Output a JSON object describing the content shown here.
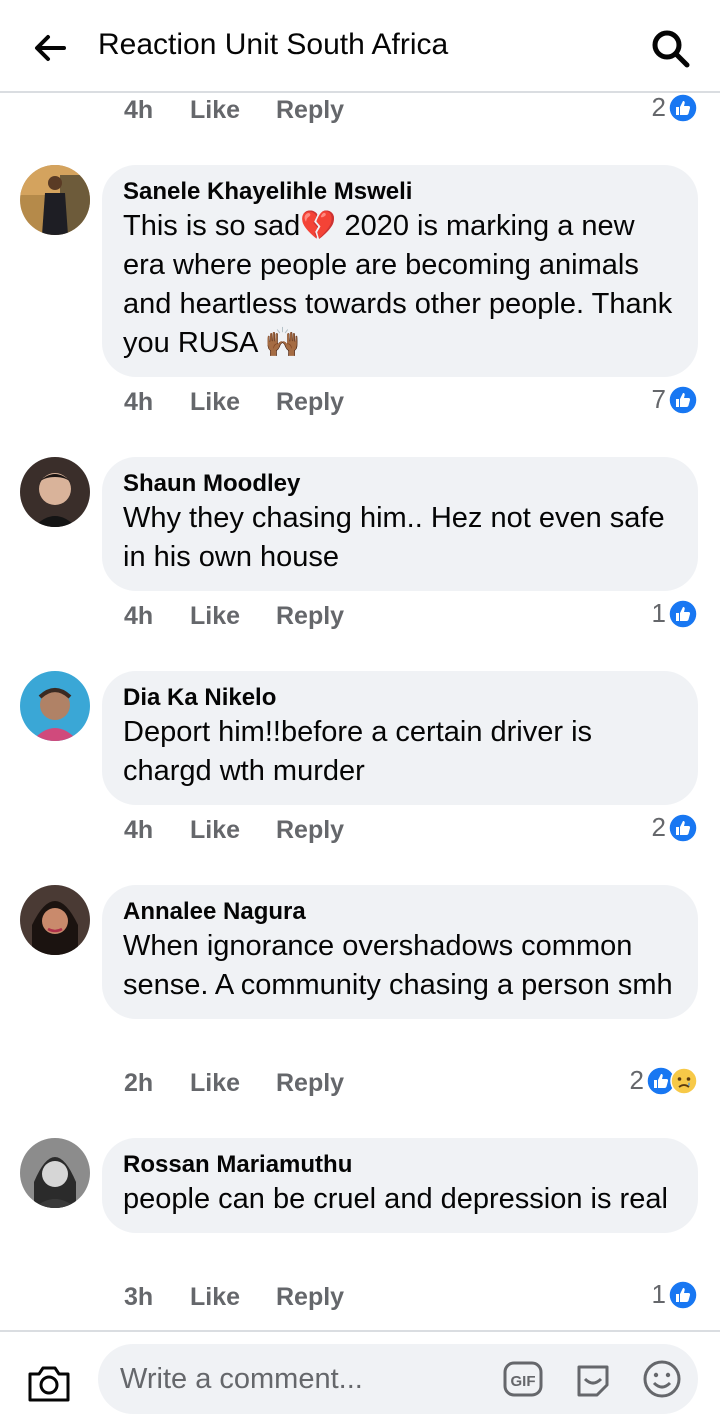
{
  "header": {
    "title": "Reaction Unit South Africa"
  },
  "top_meta": {
    "time": "4h",
    "like": "Like",
    "reply": "Reply",
    "reaction_count": "2"
  },
  "comments": [
    {
      "author": "Sanele Khayelihle Msweli",
      "text": "This is so sad💔 2020 is marking a new era where people are becoming animals and heartless towards other people. Thank you RUSA 🙌🏾",
      "time": "4h",
      "like": "Like",
      "reply": "Reply",
      "reaction_count": "7",
      "reactions": [
        "like-icon"
      ]
    },
    {
      "author": "Shaun Moodley",
      "text": "Why they chasing him.. Hez not even safe in his own house",
      "time": "4h",
      "like": "Like",
      "reply": "Reply",
      "reaction_count": "1",
      "reactions": [
        "like-icon"
      ]
    },
    {
      "author": "Dia Ka Nikelo",
      "text": "Deport him!!before a certain driver is chargd wth murder",
      "time": "4h",
      "like": "Like",
      "reply": "Reply",
      "reaction_count": "2",
      "reactions": [
        "like-icon"
      ]
    },
    {
      "author": "Annalee Nagura",
      "text": "When ignorance overshadows common sense. A community chasing a person smh",
      "time": "2h",
      "like": "Like",
      "reply": "Reply",
      "reaction_count": "2",
      "reactions": [
        "like-icon",
        "sad-icon"
      ]
    },
    {
      "author": "Rossan Mariamuthu",
      "text": "people can be cruel and depression is real",
      "time": "3h",
      "like": "Like",
      "reply": "Reply",
      "reaction_count": "1",
      "reactions": [
        "like-icon"
      ]
    }
  ],
  "composer": {
    "placeholder": "Write a comment..."
  },
  "colors": {
    "like_blue": "#1877f2",
    "bubble_bg": "#f0f2f5",
    "meta_gray": "#65676b"
  }
}
